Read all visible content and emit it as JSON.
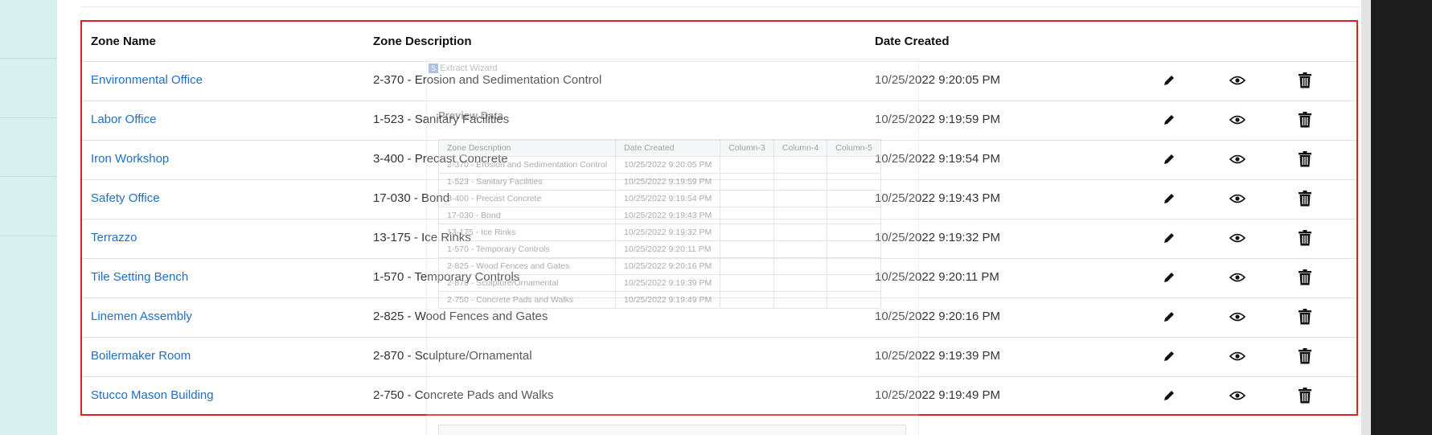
{
  "table": {
    "headers": {
      "zone_name": "Zone Name",
      "zone_description": "Zone Description",
      "date_created": "Date Created"
    },
    "rows": [
      {
        "name": "Environmental Office",
        "description": "2-370 - Erosion and Sedimentation Control",
        "date": "10/25/2022 9:20:05 PM"
      },
      {
        "name": "Labor Office",
        "description": "1-523 - Sanitary Facilities",
        "date": "10/25/2022 9:19:59 PM"
      },
      {
        "name": "Iron Workshop",
        "description": "3-400 - Precast Concrete",
        "date": "10/25/2022 9:19:54 PM"
      },
      {
        "name": "Safety Office",
        "description": "17-030 - Bond",
        "date": "10/25/2022 9:19:43 PM"
      },
      {
        "name": "Terrazzo",
        "description": "13-175 - Ice Rinks",
        "date": "10/25/2022 9:19:32 PM"
      },
      {
        "name": "Tile Setting Bench",
        "description": "1-570 - Temporary Controls",
        "date": "10/25/2022 9:20:11 PM"
      },
      {
        "name": "Linemen Assembly",
        "description": "2-825 - Wood Fences and Gates",
        "date": "10/25/2022 9:20:16 PM"
      },
      {
        "name": "Boilermaker Room",
        "description": "2-870 - Sculpture/Ornamental",
        "date": "10/25/2022 9:19:39 PM"
      },
      {
        "name": "Stucco Mason Building",
        "description": "2-750 - Concrete Pads and Walks",
        "date": "10/25/2022 9:19:49 PM"
      }
    ],
    "actions": [
      "pencil-icon",
      "eye-icon",
      "trash-icon"
    ]
  },
  "overlay": {
    "title": "Extract Wizard",
    "heading": "Preview Data",
    "columns": [
      "Zone Description",
      "Date Created",
      "Column-3",
      "Column-4",
      "Column-5"
    ],
    "rows": [
      [
        "2-370 - Erosion and Sedimentation Control",
        "10/25/2022 9:20:05 PM"
      ],
      [
        "1-523 - Sanitary Facilities",
        "10/25/2022 9:19:59 PM"
      ],
      [
        "3-400 - Precast Concrete",
        "10/25/2022 9:19:54 PM"
      ],
      [
        "17-030 - Bond",
        "10/25/2022 9:19:43 PM"
      ],
      [
        "13-175 - Ice Rinks",
        "10/25/2022 9:19:32 PM"
      ],
      [
        "1-570 - Temporary Controls",
        "10/25/2022 9:20:11 PM"
      ],
      [
        "2-825 - Wood Fences and Gates",
        "10/25/2022 9:20:16 PM"
      ],
      [
        "2-870 - Sculpture/Ornamental",
        "10/25/2022 9:19:39 PM"
      ],
      [
        "2-750 - Concrete Pads and Walks",
        "10/25/2022 9:19:49 PM"
      ]
    ]
  },
  "colors": {
    "link": "#1f6fc5",
    "highlight_border": "#e0201f",
    "sidebar": "#d9f0ee"
  }
}
